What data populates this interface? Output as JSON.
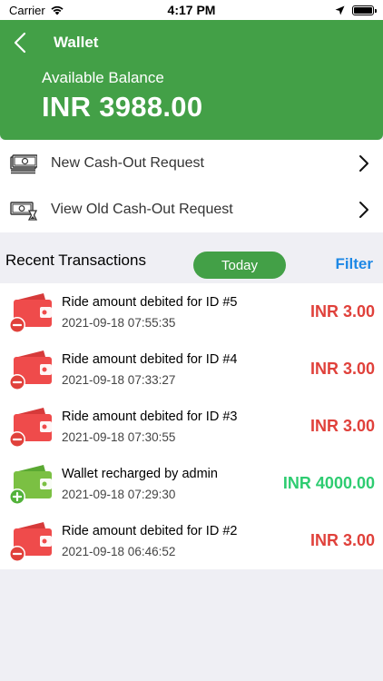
{
  "status_bar": {
    "carrier": "Carrier",
    "time": "4:17 PM"
  },
  "nav": {
    "title": "Wallet",
    "bar_color": "#43a047"
  },
  "balance": {
    "label": "Available Balance",
    "value": "INR 3988.00"
  },
  "menu": {
    "items": [
      {
        "label": "New Cash-Out Request",
        "icon": "cash-icon"
      },
      {
        "label": "View Old Cash-Out Request",
        "icon": "cash-history-icon"
      }
    ]
  },
  "recent": {
    "title": "Recent Transactions",
    "today_label": "Today",
    "filter_label": "Filter"
  },
  "transactions": [
    {
      "title": "Ride amount debited for ID #5",
      "date": "2021-09-18 07:55:35",
      "amount": "INR 3.00",
      "type": "debit"
    },
    {
      "title": "Ride amount debited for ID #4",
      "date": "2021-09-18 07:33:27",
      "amount": "INR 3.00",
      "type": "debit"
    },
    {
      "title": "Ride amount debited for ID #3",
      "date": "2021-09-18 07:30:55",
      "amount": "INR 3.00",
      "type": "debit"
    },
    {
      "title": "Wallet recharged by admin",
      "date": "2021-09-18 07:29:30",
      "amount": "INR 4000.00",
      "type": "credit"
    },
    {
      "title": "Ride amount debited for ID #2",
      "date": "2021-09-18 06:46:52",
      "amount": "INR 3.00",
      "type": "debit"
    }
  ],
  "colors": {
    "debit": "#e0413b",
    "credit": "#2ecc71",
    "filter": "#1e88e5"
  }
}
